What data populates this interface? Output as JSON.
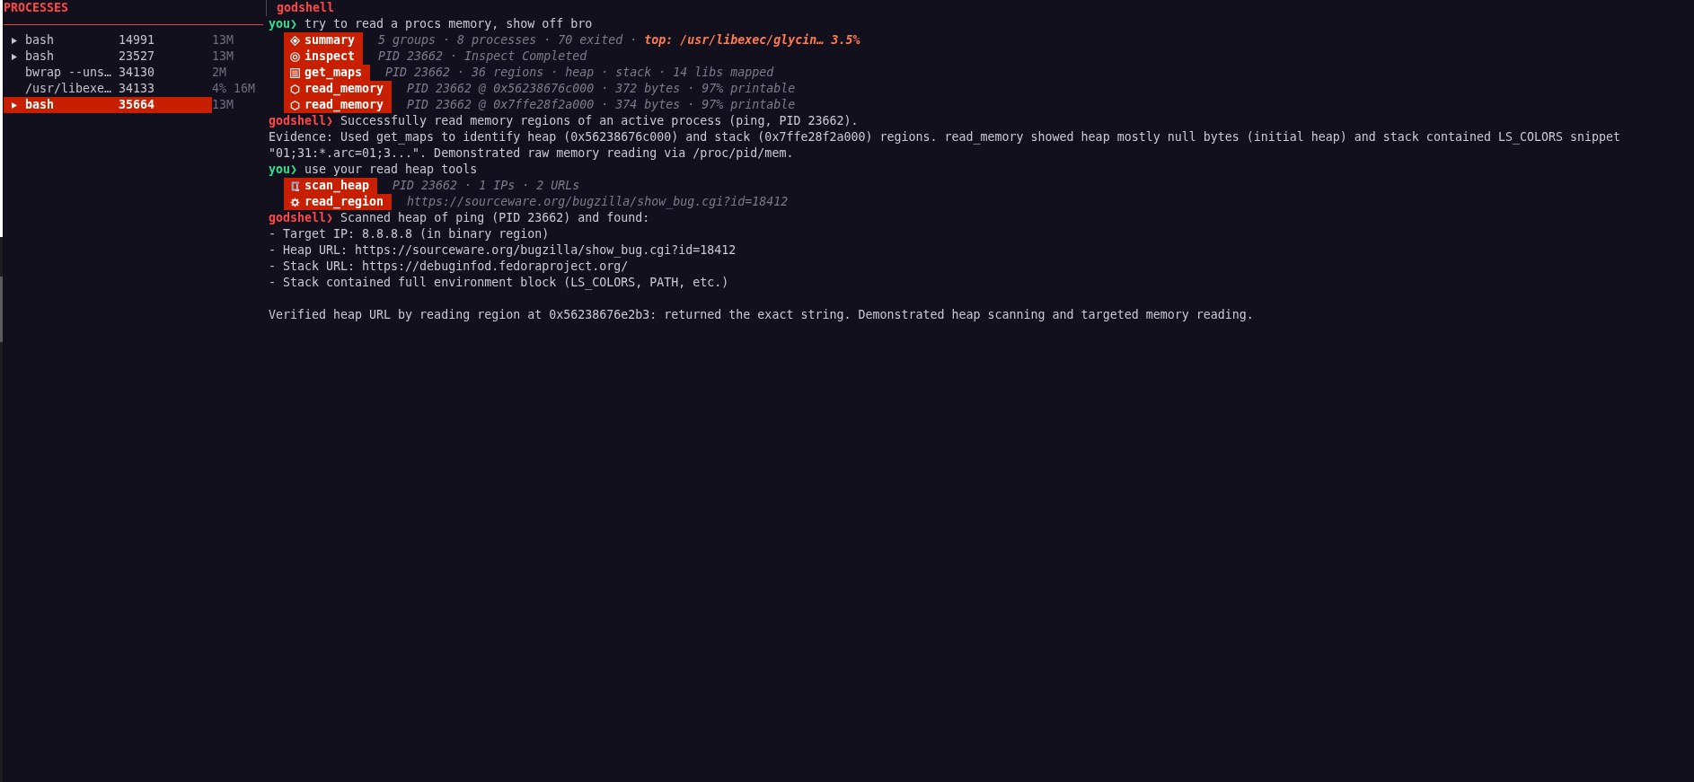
{
  "sidebar": {
    "title": "PROCESSES",
    "processes": [
      {
        "name": "bash",
        "pid": "14991",
        "usage": "13M",
        "expandable": true,
        "selected": false
      },
      {
        "name": "bash",
        "pid": "23527",
        "usage": "13M",
        "expandable": true,
        "selected": false
      },
      {
        "name": "bwrap --uns…",
        "pid": "34130",
        "usage": "2M",
        "expandable": false,
        "selected": false
      },
      {
        "name": "/usr/libexe…",
        "pid": "34133",
        "usage": "4% 16M",
        "expandable": false,
        "selected": false
      },
      {
        "name": "bash",
        "pid": "35664",
        "usage": "13M",
        "expandable": true,
        "selected": true
      }
    ]
  },
  "chat": {
    "title": "godshell",
    "messages": [
      {
        "kind": "user",
        "prompt": "you❯",
        "text": "try to read a procs memory, show off bro"
      },
      {
        "kind": "tools",
        "calls": [
          {
            "kind": "summary",
            "name": "summary",
            "detail": "5 groups · 8 processes · 70 exited ·",
            "highlight": "top: /usr/libexec/glycin… 3.5%"
          },
          {
            "kind": "inspect",
            "name": "inspect",
            "detail": "PID 23662 · Inspect Completed"
          },
          {
            "kind": "maps",
            "name": "get_maps",
            "detail": "PID 23662 · 36 regions · heap · stack · 14 libs mapped"
          },
          {
            "kind": "memory",
            "name": "read_memory",
            "detail": "PID 23662 @ 0x56238676c000 · 372 bytes · 97% printable"
          },
          {
            "kind": "memory",
            "name": "read_memory",
            "detail": "PID 23662 @ 0x7ffe28f2a000 · 374 bytes · 97% printable"
          }
        ]
      },
      {
        "kind": "assistant",
        "prompt": "godshell❯",
        "text": "Successfully read memory regions of an active process (ping, PID 23662).",
        "blocks": [
          {
            "lines": [
              "Evidence: Used get_maps to identify heap (0x56238676c000) and stack (0x7ffe28f2a000) regions. read_memory showed heap mostly null bytes (initial heap) and stack contained LS_COLORS snippet \"01;31:*.arc=01;3...\". Demonstrated raw memory reading via /proc/pid/mem."
            ]
          }
        ]
      },
      {
        "kind": "user",
        "prompt": "you❯",
        "text": "use your read heap tools"
      },
      {
        "kind": "tools",
        "calls": [
          {
            "kind": "scan",
            "name": "scan_heap",
            "detail": "PID 23662 · 1 IPs · 2 URLs"
          },
          {
            "kind": "region",
            "name": "read_region",
            "detail": "https://sourceware.org/bugzilla/show_bug.cgi?id=18412"
          }
        ]
      },
      {
        "kind": "assistant",
        "prompt": "godshell❯",
        "text": "Scanned heap of ping (PID 23662) and found:",
        "blocks": [
          {
            "lines": [
              "- Target IP: 8.8.8.8 (in binary region)",
              "- Heap URL: https://sourceware.org/bugzilla/show_bug.cgi?id=18412",
              "- Stack URL: https://debuginfod.fedoraproject.org/",
              "- Stack contained full environment block (LS_COLORS, PATH, etc.)"
            ]
          },
          {
            "lines": [
              "Verified heap URL by reading region at 0x56238676e2b3: returned the exact string. Demonstrated heap scanning and targeted memory reading."
            ]
          }
        ]
      }
    ]
  }
}
